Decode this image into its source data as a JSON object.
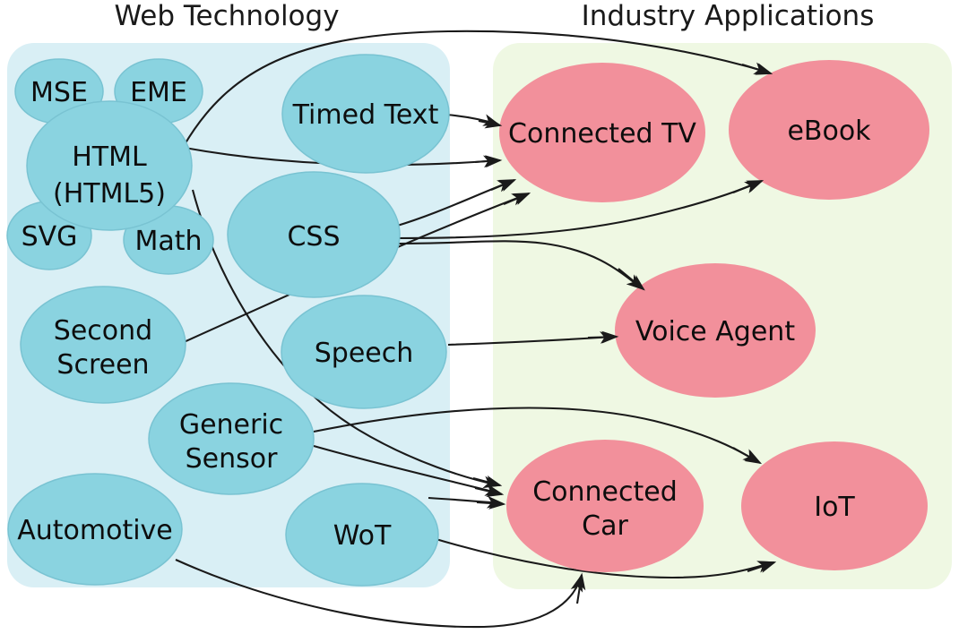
{
  "diagram": {
    "title_left": "Web Technology",
    "title_right": "Industry Applications",
    "colors": {
      "web_panel_bg": "#d9eff5",
      "industry_panel_bg": "#eff8e3",
      "web_node_fill": "#8ad3e0",
      "web_node_stroke": "#79c3d2",
      "industry_node_fill": "#f2909b",
      "edge_stroke": "#1a1a1a",
      "text": "#0d0d0d"
    }
  },
  "web_technology": {
    "label": "Web Technology",
    "nodes": [
      {
        "id": "mse",
        "label": "MSE"
      },
      {
        "id": "eme",
        "label": "EME"
      },
      {
        "id": "html",
        "label": "HTML",
        "label2": "(HTML5)"
      },
      {
        "id": "svg",
        "label": "SVG"
      },
      {
        "id": "math",
        "label": "Math"
      },
      {
        "id": "timed-text",
        "label": "Timed Text"
      },
      {
        "id": "css",
        "label": "CSS"
      },
      {
        "id": "second-screen",
        "label": "Second",
        "label2": "Screen"
      },
      {
        "id": "speech",
        "label": "Speech"
      },
      {
        "id": "generic-sensor",
        "label": "Generic",
        "label2": "Sensor"
      },
      {
        "id": "automotive",
        "label": "Automotive"
      },
      {
        "id": "wot",
        "label": "WoT"
      }
    ]
  },
  "industry_applications": {
    "label": "Industry Applications",
    "nodes": [
      {
        "id": "connected-tv",
        "label": "Connected TV"
      },
      {
        "id": "ebook",
        "label": "eBook"
      },
      {
        "id": "voice-agent",
        "label": "Voice Agent"
      },
      {
        "id": "connected-car",
        "label": "Connected",
        "label2": "Car"
      },
      {
        "id": "iot",
        "label": "IoT"
      }
    ]
  },
  "edges": [
    {
      "from": "html",
      "to": "ebook"
    },
    {
      "from": "timed-text",
      "to": "connected-tv"
    },
    {
      "from": "html",
      "to": "connected-tv"
    },
    {
      "from": "css",
      "to": "connected-tv"
    },
    {
      "from": "css",
      "to": "ebook"
    },
    {
      "from": "css",
      "to": "voice-agent"
    },
    {
      "from": "second-screen",
      "to": "connected-tv"
    },
    {
      "from": "speech",
      "to": "voice-agent"
    },
    {
      "from": "html",
      "to": "connected-car"
    },
    {
      "from": "generic-sensor",
      "to": "connected-car"
    },
    {
      "from": "generic-sensor",
      "to": "iot"
    },
    {
      "from": "wot",
      "to": "connected-car"
    },
    {
      "from": "wot",
      "to": "iot"
    },
    {
      "from": "automotive",
      "to": "connected-car"
    }
  ]
}
